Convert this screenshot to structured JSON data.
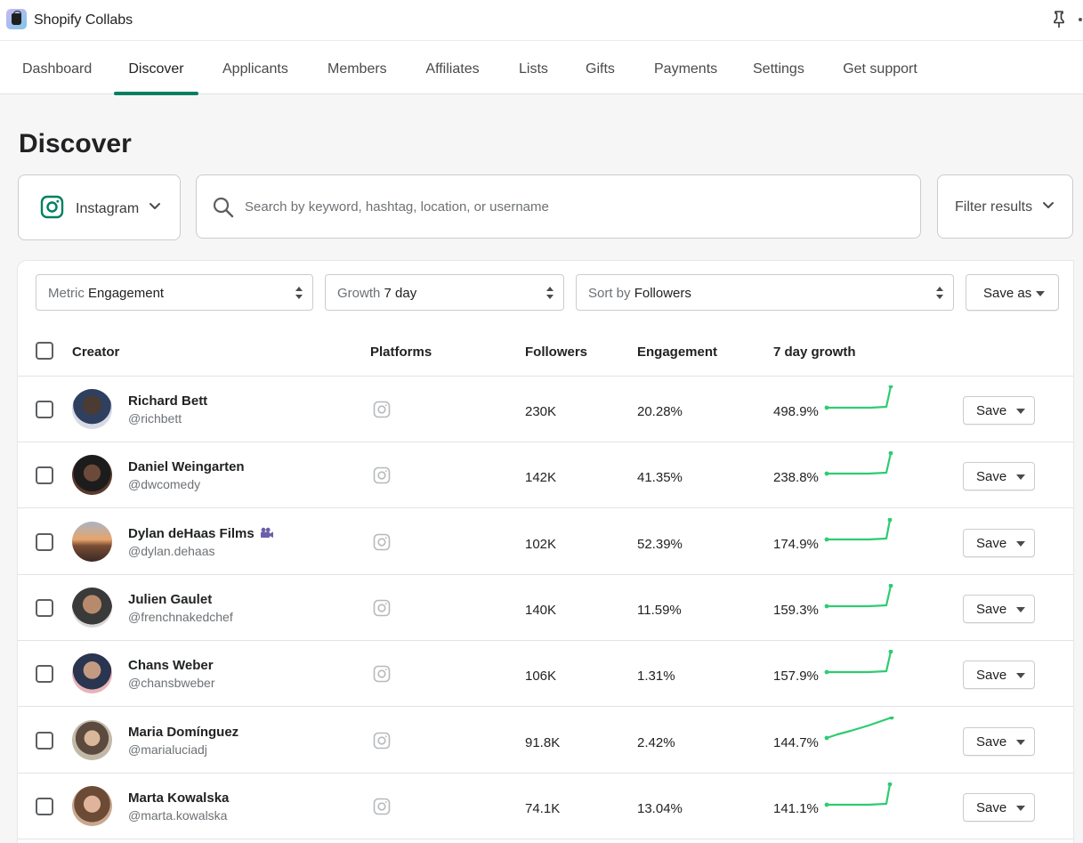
{
  "app": {
    "title": "Shopify Collabs",
    "icons": [
      "shopify-bag-icon",
      "pin-icon",
      "more-icon"
    ]
  },
  "nav": {
    "tabs": [
      {
        "label": "Dashboard",
        "active": false
      },
      {
        "label": "Discover",
        "active": true
      },
      {
        "label": "Applicants",
        "active": false
      },
      {
        "label": "Members",
        "active": false
      },
      {
        "label": "Affiliates",
        "active": false
      },
      {
        "label": "Lists",
        "active": false
      },
      {
        "label": "Gifts",
        "active": false
      },
      {
        "label": "Payments",
        "active": false
      },
      {
        "label": "Settings",
        "active": false
      },
      {
        "label": "Get support",
        "active": false
      }
    ]
  },
  "page": {
    "title": "Discover"
  },
  "platform_select": {
    "value": "Instagram"
  },
  "search": {
    "placeholder": "Search by keyword, hashtag, location, or username",
    "value": ""
  },
  "filter": {
    "label": "Filter results"
  },
  "controls": {
    "metric": {
      "prefix": "Metric",
      "value": "Engagement"
    },
    "growth": {
      "prefix": "Growth",
      "value": "7 day"
    },
    "sort": {
      "prefix": "Sort by",
      "value": "Followers"
    },
    "save_as": "Save as"
  },
  "table": {
    "headers": {
      "creator": "Creator",
      "platforms": "Platforms",
      "followers": "Followers",
      "engagement": "Engagement",
      "growth": "7 day growth"
    },
    "save_label": "Save",
    "rows": [
      {
        "name": "Richard Bett",
        "handle": "@richbett",
        "followers": "230K",
        "engagement": "20.28%",
        "growth": "498.9%",
        "verified_creator": false
      },
      {
        "name": "Daniel Weingarten",
        "handle": "@dwcomedy",
        "followers": "142K",
        "engagement": "41.35%",
        "growth": "238.8%",
        "verified_creator": false
      },
      {
        "name": "Dylan deHaas Films",
        "handle": "@dylan.dehaas",
        "followers": "102K",
        "engagement": "52.39%",
        "growth": "174.9%",
        "verified_creator": true
      },
      {
        "name": "Julien Gaulet",
        "handle": "@frenchnakedchef",
        "followers": "140K",
        "engagement": "11.59%",
        "growth": "159.3%",
        "verified_creator": false
      },
      {
        "name": "Chans Weber",
        "handle": "@chansbweber",
        "followers": "106K",
        "engagement": "1.31%",
        "growth": "157.9%",
        "verified_creator": false
      },
      {
        "name": "Maria Domínguez",
        "handle": "@marialuciadj",
        "followers": "91.8K",
        "engagement": "2.42%",
        "growth": "144.7%",
        "verified_creator": false
      },
      {
        "name": "Marta Kowalska",
        "handle": "@marta.kowalska",
        "followers": "74.1K",
        "engagement": "13.04%",
        "growth": "141.1%",
        "verified_creator": false
      }
    ]
  },
  "colors": {
    "accent": "#008060",
    "sparkline": "#2ecc71",
    "border": "#c9cccf"
  }
}
